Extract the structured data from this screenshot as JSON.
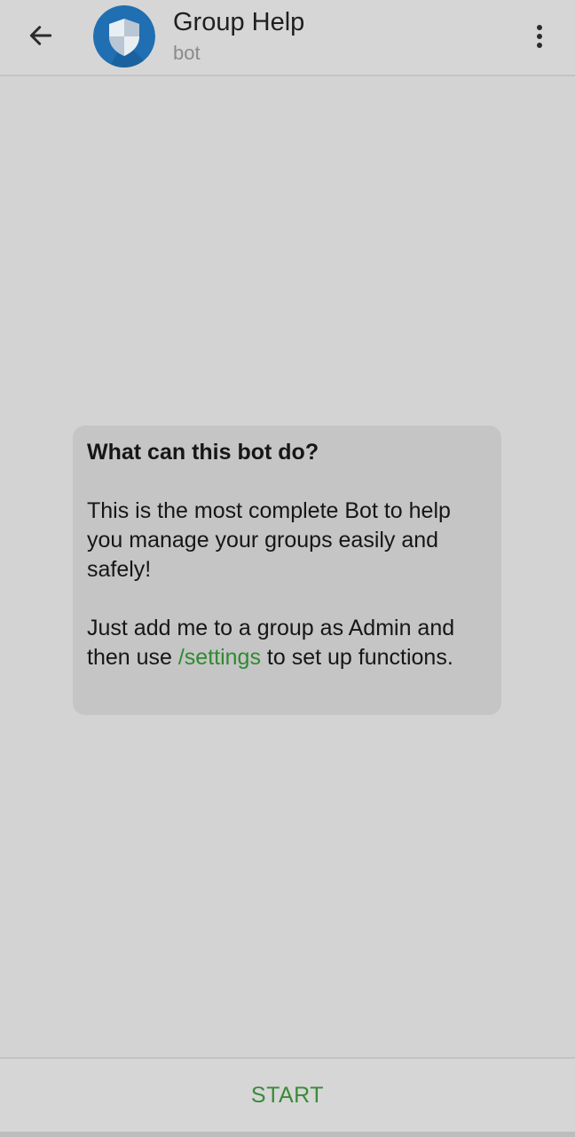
{
  "header": {
    "back_icon": "arrow-left-icon",
    "avatar_icon": "shield-icon",
    "title": "Group Help",
    "subtitle": "bot",
    "menu_icon": "more-vertical-icon"
  },
  "card": {
    "heading": "What can this bot do?",
    "paragraph1": "This is the most complete Bot to help you manage your groups easily and safely!",
    "paragraph2_before": "Just add me to a group as Admin and then use ",
    "paragraph2_link": "/settings",
    "paragraph2_after": " to set up functions."
  },
  "bottom": {
    "start_label": "START"
  },
  "colors": {
    "background": "#d3d3d3",
    "card": "#c5c5c5",
    "accent_green": "#3a8a3a",
    "avatar_blue": "#1f6fb2"
  }
}
